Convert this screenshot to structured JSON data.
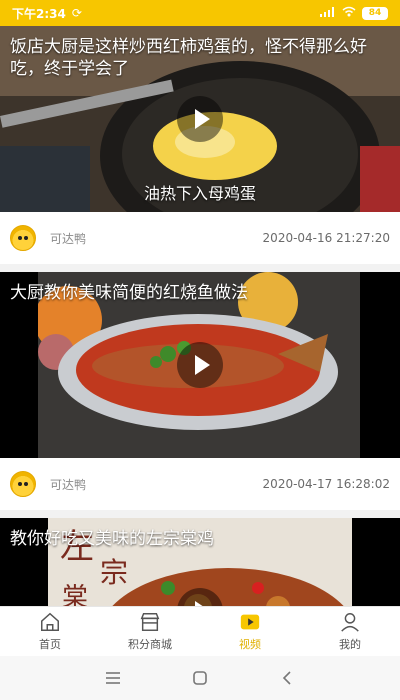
{
  "status_bar": {
    "time": "下午2:34",
    "battery": "84"
  },
  "feed": [
    {
      "title": "饭店大厨是这样炒西红柿鸡蛋的，怪不得那么好吃，终于学会了",
      "caption": "油热下入母鸡蛋",
      "author": "可达鸭",
      "date": "2020-04-16 21:27:20"
    },
    {
      "title": "大厨教你美味简便的红烧鱼做法",
      "caption": "",
      "author": "可达鸭",
      "date": "2020-04-17 16:28:02"
    },
    {
      "title": "教你好吃又美味的左宗棠鸡",
      "caption": "",
      "author": "",
      "date": ""
    }
  ],
  "tabs": [
    {
      "label": "首页",
      "icon": "home-icon"
    },
    {
      "label": "积分商城",
      "icon": "store-icon"
    },
    {
      "label": "视频",
      "icon": "video-icon",
      "active": true
    },
    {
      "label": "我的",
      "icon": "profile-icon"
    }
  ],
  "colors": {
    "accent": "#f7c600",
    "active_tab": "#e0b000"
  }
}
